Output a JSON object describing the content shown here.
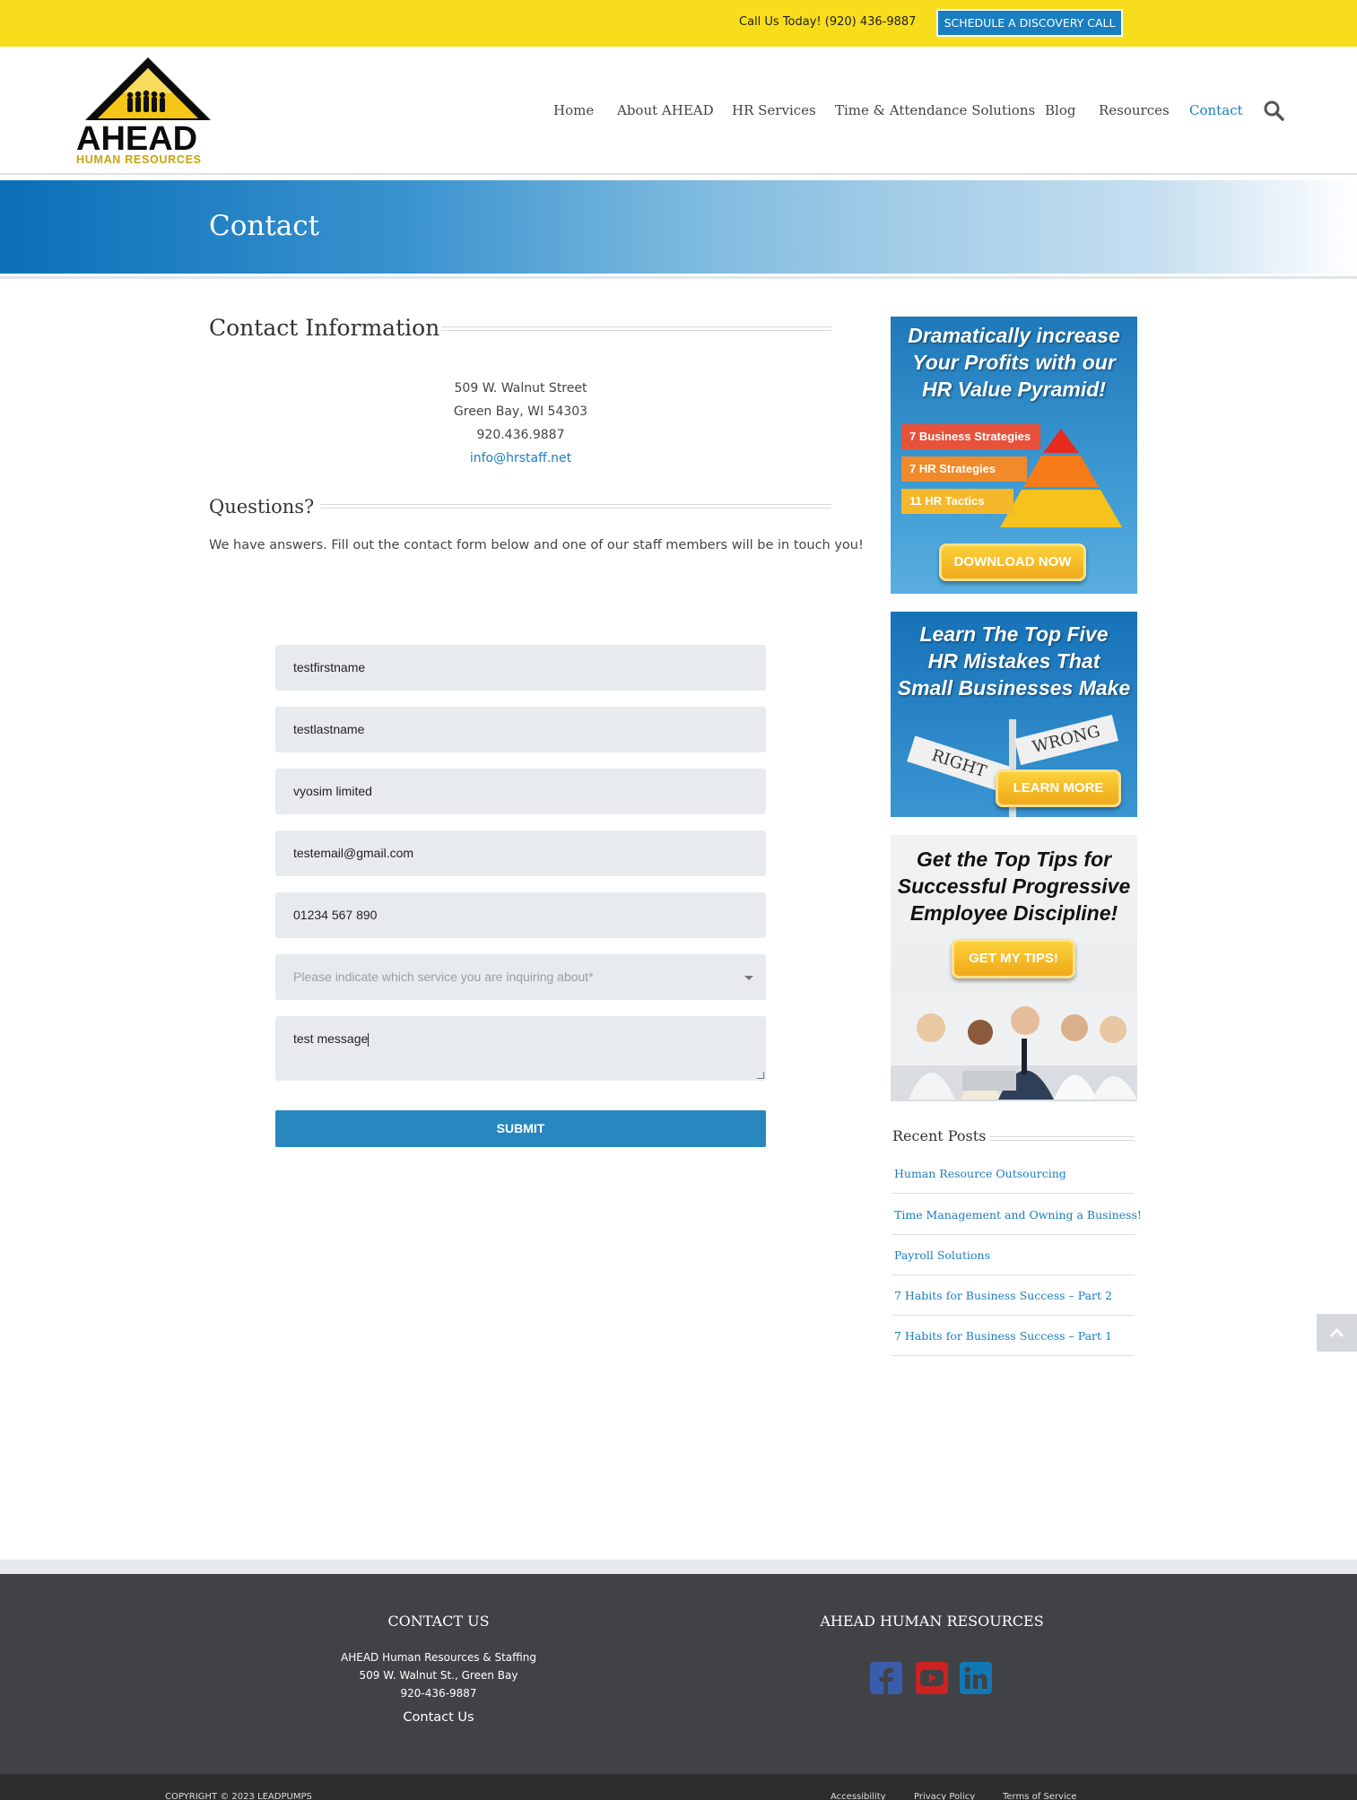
{
  "topbar": {
    "call_text": "Call Us Today! (920) 436-9887",
    "schedule_button": "SCHEDULE A DISCOVERY CALL"
  },
  "brand": {
    "logo_word": "AHEAD",
    "logo_sub": "HUMAN RESOURCES"
  },
  "nav": {
    "items": [
      {
        "label": "Home"
      },
      {
        "label": "About AHEAD"
      },
      {
        "label": "HR Services"
      },
      {
        "label": "Time & Attendance Solutions"
      },
      {
        "label": "Blog"
      },
      {
        "label": "Resources"
      },
      {
        "label": "Contact"
      }
    ],
    "active": "Contact",
    "search_icon": "search-icon"
  },
  "page_title": "Contact",
  "contact_info": {
    "heading": "Contact Information",
    "street": "509 W. Walnut Street",
    "city": "Green Bay, WI 54303",
    "phone": "920.436.9887",
    "email": "info@hrstaff.net"
  },
  "questions": {
    "heading": "Questions?",
    "text": "We have answers. Fill out the contact form below and one of our staff members will be in touch you!"
  },
  "form": {
    "first_name": "testfirstname",
    "last_name": "testlastname",
    "company": "vyosim limited",
    "email": "testemail@gmail.com",
    "phone": "01234 567 890",
    "service_placeholder": "Please indicate which service you are inquiring about*",
    "message": "test message",
    "submit_label": "SUBMIT"
  },
  "sidebar": {
    "ad1": {
      "headline": [
        "Dramatically increase",
        "Your Profits with our",
        "HR Value Pyramid!"
      ],
      "tiers": [
        "7 Business Strategies",
        "7 HR Strategies",
        "11 HR Tactics"
      ],
      "button": "DOWNLOAD NOW"
    },
    "ad2": {
      "headline": [
        "Learn The Top Five",
        "HR Mistakes That",
        "Small Businesses Make"
      ],
      "sign_right": "RIGHT",
      "sign_wrong": "WRONG",
      "button": "LEARN MORE"
    },
    "ad3": {
      "headline": [
        "Get the Top Tips for",
        "Successful Progressive",
        "Employee Discipline!"
      ],
      "button": "GET MY TIPS!"
    },
    "recent_posts_title": "Recent Posts",
    "recent_posts": [
      "Human Resource Outsourcing",
      "Time Management and Owning a Business!",
      "Payroll Solutions",
      "7 Habits for Business Success – Part 2",
      "7 Habits for Business Success – Part 1"
    ]
  },
  "footer": {
    "contact_heading": "CONTACT US",
    "company_name": "AHEAD Human Resources & Staffing",
    "address": "509 W. Walnut St., Green Bay",
    "phone": "920-436-9887",
    "contact_link": "Contact Us",
    "ahead_heading": "AHEAD HUMAN RESOURCES",
    "social_icons": [
      "facebook-icon",
      "youtube-icon",
      "linkedin-icon"
    ],
    "copyright": "COPYRIGHT © 2023 LEADPUMPS",
    "links": [
      "Accessibility",
      "Privacy Policy",
      "Terms of Service"
    ]
  },
  "colors": {
    "topbar": "#f8dd1c",
    "accent": "#1a7ec0",
    "submit": "#2887be",
    "footer": "#404245"
  }
}
